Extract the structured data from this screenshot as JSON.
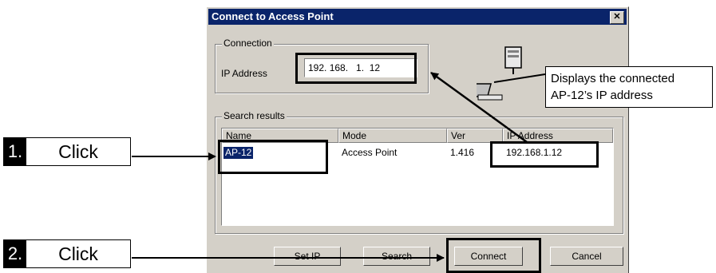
{
  "dialog": {
    "title": "Connect to Access Point",
    "close_glyph": "✕",
    "connection": {
      "legend": "Connection",
      "ip_label": "IP Address",
      "ip_value": "192. 168.   1.  12"
    },
    "search": {
      "legend": "Search results",
      "columns": [
        "Name",
        "Mode",
        "Ver",
        "IP Address"
      ],
      "rows": [
        {
          "name": "AP-12",
          "mode": "Access Point",
          "ver": "1.416",
          "ip": "192.168.1.12"
        }
      ]
    },
    "buttons": {
      "set_ip": "Set IP",
      "search": "Search",
      "connect": "Connect",
      "cancel": "Cancel"
    },
    "icons": [
      "network-computers-icon"
    ]
  },
  "annotations": {
    "callout": {
      "line1": "Displays the connected",
      "line2": "AP-12’s IP address"
    },
    "steps": [
      {
        "number": "1.",
        "label": "Click"
      },
      {
        "number": "2.",
        "label": "Click"
      }
    ]
  },
  "colors": {
    "titlebar": "#0a246a",
    "dialog_face": "#d4d0c8",
    "selection": "#0a246a"
  }
}
